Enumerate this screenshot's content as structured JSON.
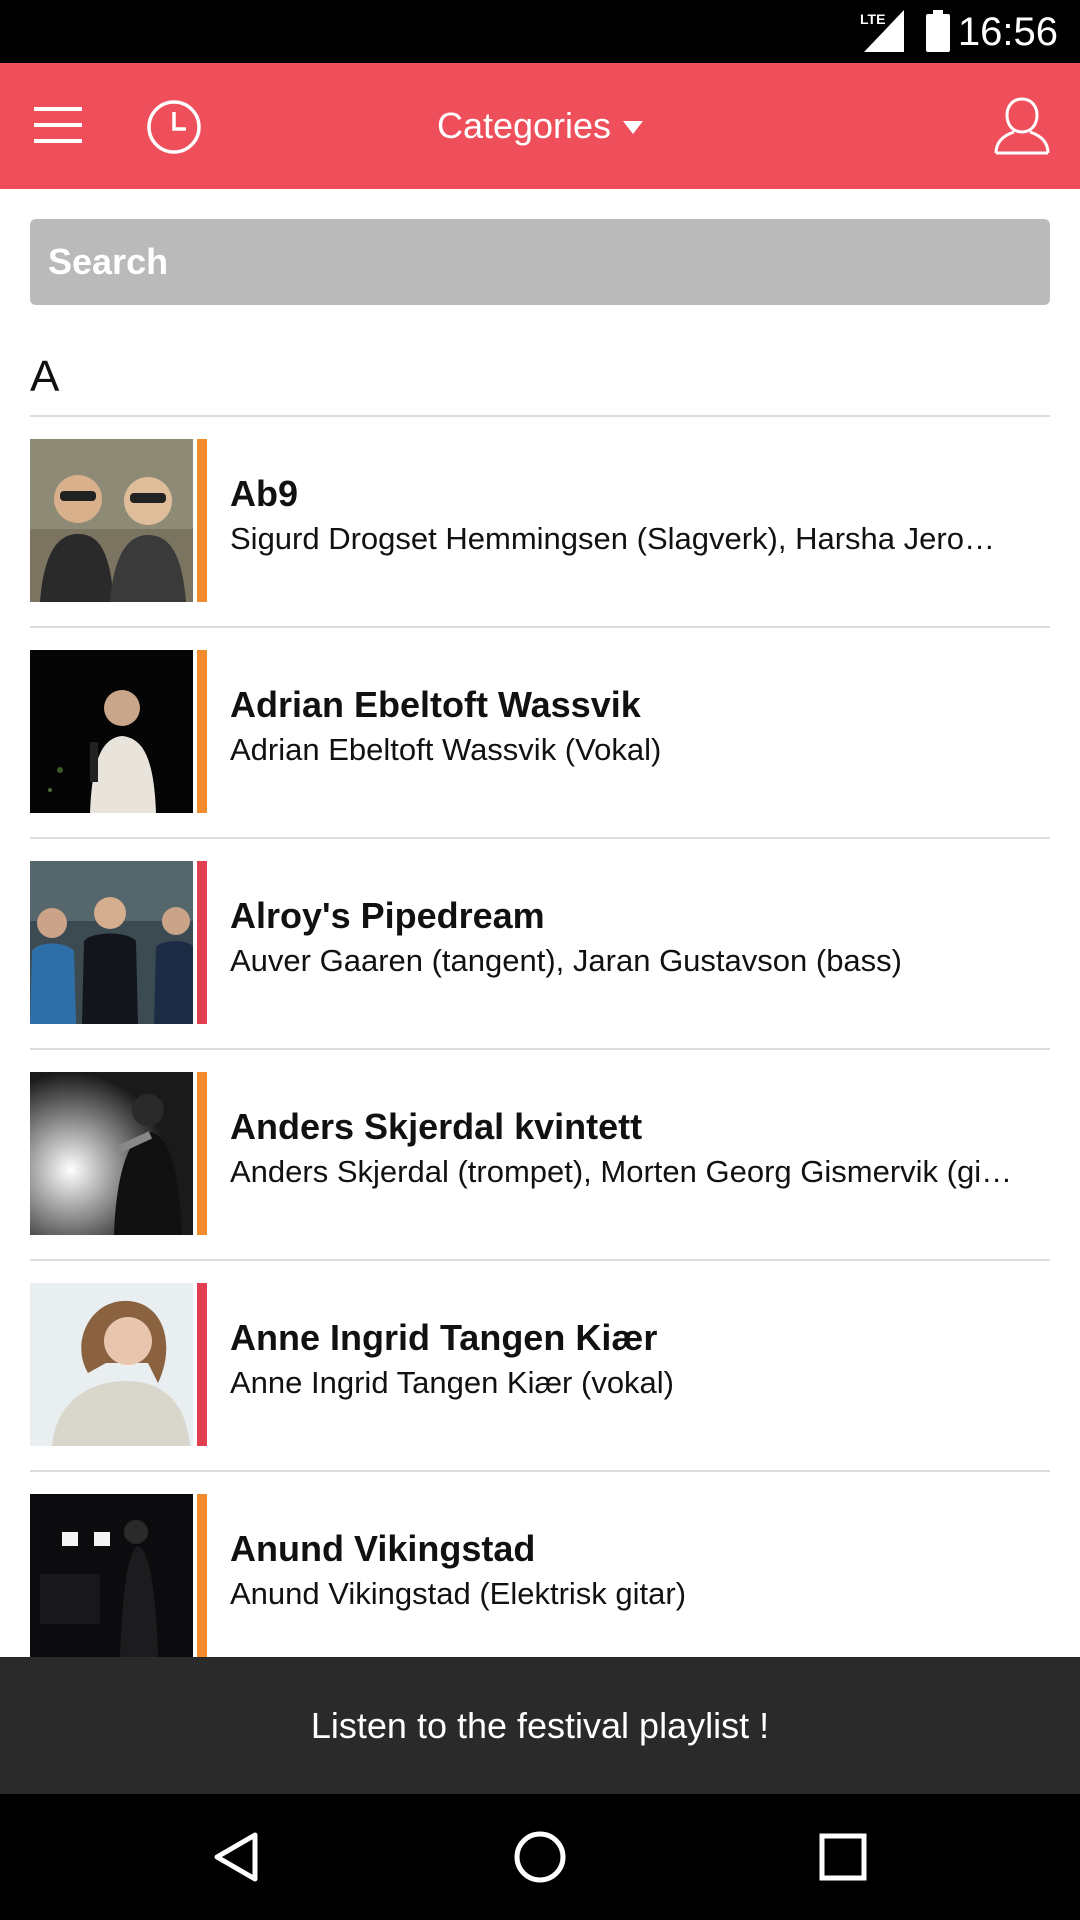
{
  "status_bar": {
    "time": "16:56",
    "network": "LTE",
    "icons": [
      "lte-signal-icon",
      "battery-icon"
    ]
  },
  "app_bar": {
    "title": "Categories",
    "background": "#ef4f5b",
    "icons": [
      "menu-icon",
      "history-clock-icon",
      "caret-down-icon",
      "profile-icon"
    ]
  },
  "search": {
    "placeholder": "Search",
    "value": ""
  },
  "section": {
    "letter": "A"
  },
  "artists": [
    {
      "name": "Ab9",
      "members": "Sigurd Drogset Hemmingsen (Slagverk), Harsha Jero…",
      "accent": "#f28a2e"
    },
    {
      "name": "Adrian Ebeltoft Wassvik",
      "members": "Adrian Ebeltoft Wassvik (Vokal)",
      "accent": "#f28a2e"
    },
    {
      "name": "Alroy's Pipedream",
      "members": "Auver Gaaren (tangent), Jaran Gustavson (bass)",
      "accent": "#e04050"
    },
    {
      "name": "Anders Skjerdal kvintett",
      "members": "Anders Skjerdal (trompet), Morten Georg Gismervik (gi…",
      "accent": "#f28a2e"
    },
    {
      "name": "Anne Ingrid Tangen Kiær",
      "members": "Anne Ingrid Tangen Kiær (vokal)",
      "accent": "#e04050"
    },
    {
      "name": "Anund Vikingstad",
      "members": "Anund Vikingstad (Elektrisk gitar)",
      "accent": "#f28a2e"
    }
  ],
  "playlist_banner": {
    "label": "Listen to the festival playlist !"
  },
  "nav_bar": {
    "icons": [
      "back-icon",
      "home-icon",
      "recents-icon"
    ]
  }
}
